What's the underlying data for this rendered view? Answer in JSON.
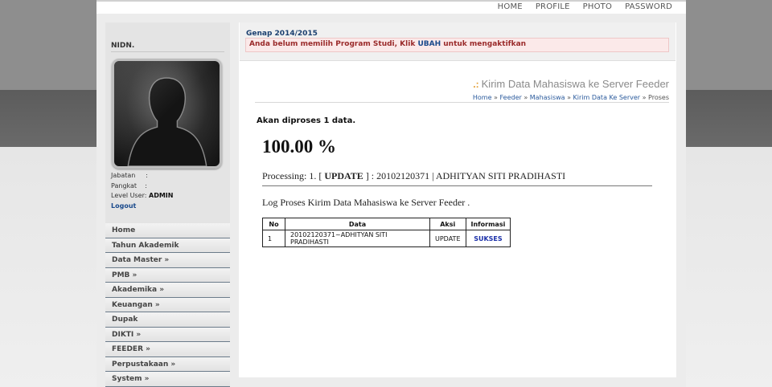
{
  "topnav": [
    "HOME",
    "PROFILE",
    "PHOTO",
    "PASSWORD"
  ],
  "sidebar": {
    "nidn_label": "NIDN.",
    "jabatan_label": "Jabatan",
    "jabatan_sep": ":",
    "pangkat_label": "Pangkat",
    "pangkat_sep": ":",
    "level_label": "Level User:",
    "level_value": "ADMIN",
    "logout": "Logout",
    "menu": [
      "Home",
      "Tahun Akademik",
      "Data Master »",
      "PMB »",
      "Akademika »",
      "Keuangan »",
      "Dupak",
      "DIKTI »",
      "FEEDER »",
      "Perpustakaan »",
      "System »"
    ]
  },
  "notice": {
    "semester": "Genap 2014/2015",
    "message_before": "Anda belum memilih Program Studi, Klik ",
    "message_link": "UBAH",
    "message_after": " untuk mengaktifkan"
  },
  "header": {
    "title": "Kirim Data Mahasiswa ke Server Feeder",
    "icon": "dots-icon",
    "breadcrumb": [
      "Home",
      "Feeder",
      "Mahasiswa",
      "Kirim Data Ke Server",
      "Proses"
    ],
    "separator": " » "
  },
  "main": {
    "akan": "Akan diproses 1 data.",
    "percent": "100.00 %",
    "processing_prefix": "Processing: 1. [",
    "processing_action": " UPDATE ",
    "processing_suffix": "] : 20102120371 | ADHITYAN SITI PRADIHASTI",
    "log": "Log Proses Kirim Data Mahasiswa ke Server Feeder ."
  },
  "table": {
    "headers": [
      "No",
      "Data",
      "Aksi",
      "Informasi"
    ],
    "rows": [
      [
        "1",
        "20102120371~ADHITYAN SITI PRADIHASTI",
        "UPDATE",
        "SUKSES"
      ]
    ]
  }
}
